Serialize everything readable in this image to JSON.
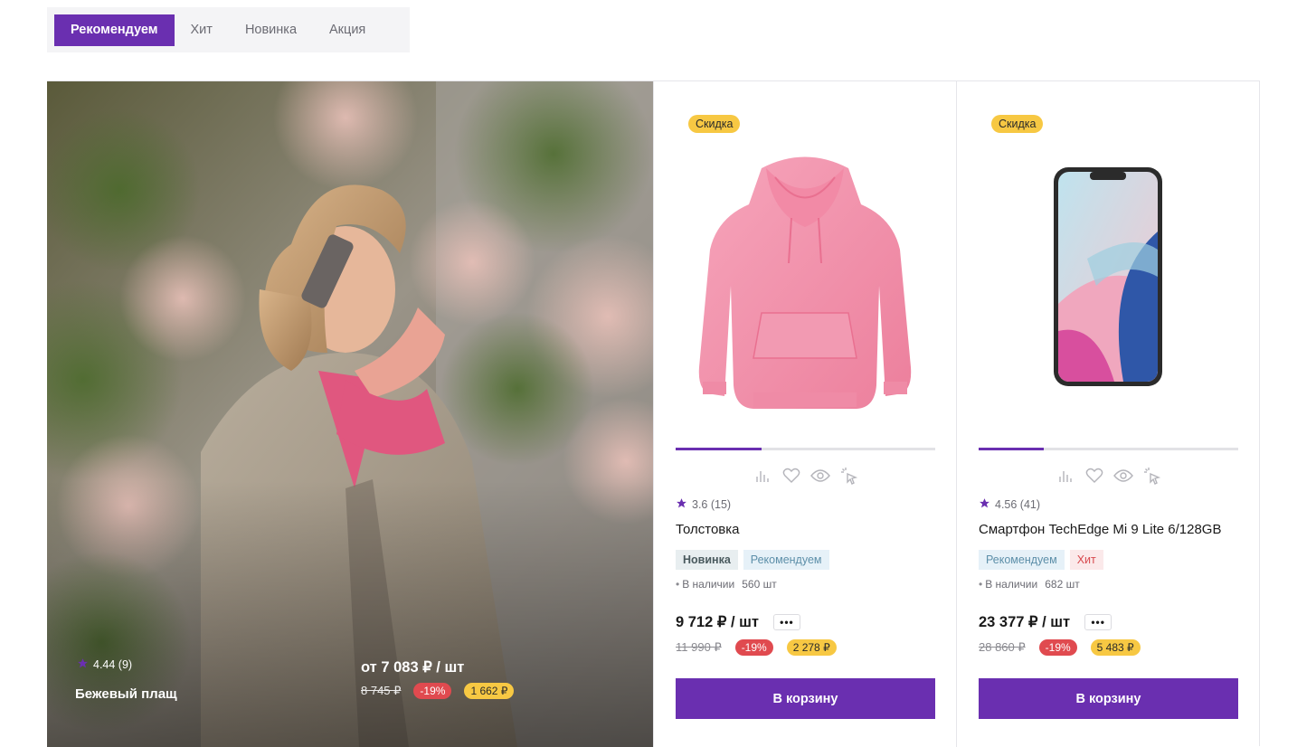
{
  "tabs": [
    {
      "label": "Рекомендуем",
      "active": true
    },
    {
      "label": "Хит",
      "active": false
    },
    {
      "label": "Новинка",
      "active": false
    },
    {
      "label": "Акция",
      "active": false
    }
  ],
  "colors": {
    "accent": "#6a2fb0",
    "sale_badge": "#f7c843",
    "discount": "#e04a4f"
  },
  "hero": {
    "rating": "4.44 (9)",
    "name": "Бежевый плащ",
    "price": "от 7 083 ₽ / шт",
    "old_price": "8 745 ₽",
    "discount": "-19%",
    "saving": "1 662 ₽",
    "rating_icon": "star-icon"
  },
  "products": [
    {
      "badge": "Скидка",
      "image_icon": "hoodie-image",
      "slider_progress": 0.33,
      "rating": "3.6 (15)",
      "title": "Толстовка",
      "tags": [
        "Новинка",
        "Рекомендуем"
      ],
      "stock_status": "В наличии",
      "stock_qty": "560 шт",
      "price": "9 712 ₽ / шт",
      "more": "•••",
      "old_price": "11 990 ₽",
      "discount": "-19%",
      "saving": "2 278 ₽",
      "cart": "В корзину"
    },
    {
      "badge": "Скидка",
      "image_icon": "smartphone-image",
      "slider_progress": 0.25,
      "rating": "4.56 (41)",
      "title": "Смартфон TechEdge Mi 9 Lite 6/128GB",
      "tags": [
        "Рекомендуем",
        "Хит"
      ],
      "stock_status": "В наличии",
      "stock_qty": "682 шт",
      "price": "23 377 ₽ / шт",
      "more": "•••",
      "old_price": "28 860 ₽",
      "discount": "-19%",
      "saving": "5 483 ₽",
      "cart": "В корзину"
    }
  ],
  "action_icons": [
    "compare-icon",
    "heart-icon",
    "eye-icon",
    "quick-buy-icon"
  ]
}
